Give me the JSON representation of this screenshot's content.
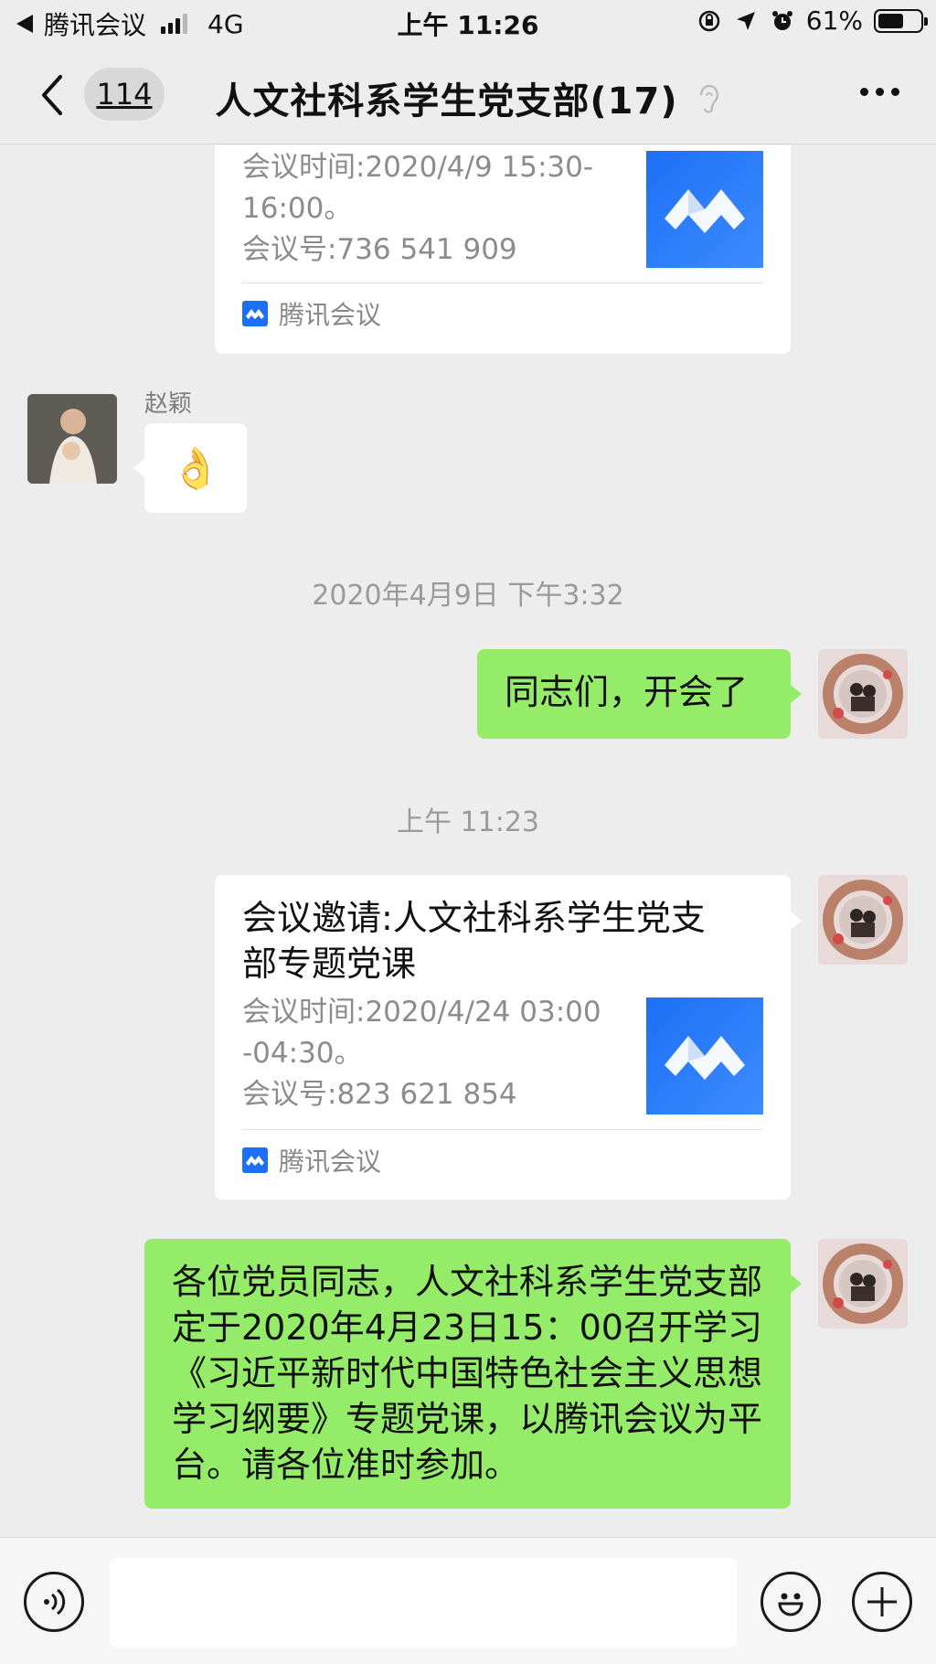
{
  "status_bar": {
    "back_app": "腾讯会议",
    "network": "4G",
    "time": "上午 11:26",
    "battery": "61%",
    "battery_level": 0.61
  },
  "nav": {
    "back_count": "114",
    "title": "人文社科系学生党支部(17)"
  },
  "messages": {
    "card1": {
      "desc": "会议时间:2020/4/9 15:30-\n16:00。\n会议号:736 541 909",
      "source": "腾讯会议"
    },
    "msg_ok": {
      "sender": "赵颖",
      "emoji": "👌"
    },
    "ts1": "2020年4月9日 下午3:32",
    "msg_meeting_start": "同志们，开会了",
    "ts2": "上午 11:23",
    "card2": {
      "title": "会议邀请:人文社科系学生党支\n部专题党课",
      "desc": "会议时间:2020/4/24 03:00\n-04:30。\n会议号:823 621 854",
      "source": "腾讯会议"
    },
    "msg_notice": "各位党员同志，人文社科系学生党支部定于2020年4月23日15：00召开学习《习近平新时代中国特色社会主义思想学习纲要》专题党课，以腾讯会议为平台。请各位准时参加。"
  },
  "colors": {
    "background": "#ededed",
    "bubble_green": "#95ec69",
    "bubble_white": "#ffffff",
    "tencent_meeting_blue": "#1d70f5"
  },
  "icons": {
    "voice": "voice-icon",
    "emoji": "emoji-icon",
    "more": "plus-icon"
  }
}
